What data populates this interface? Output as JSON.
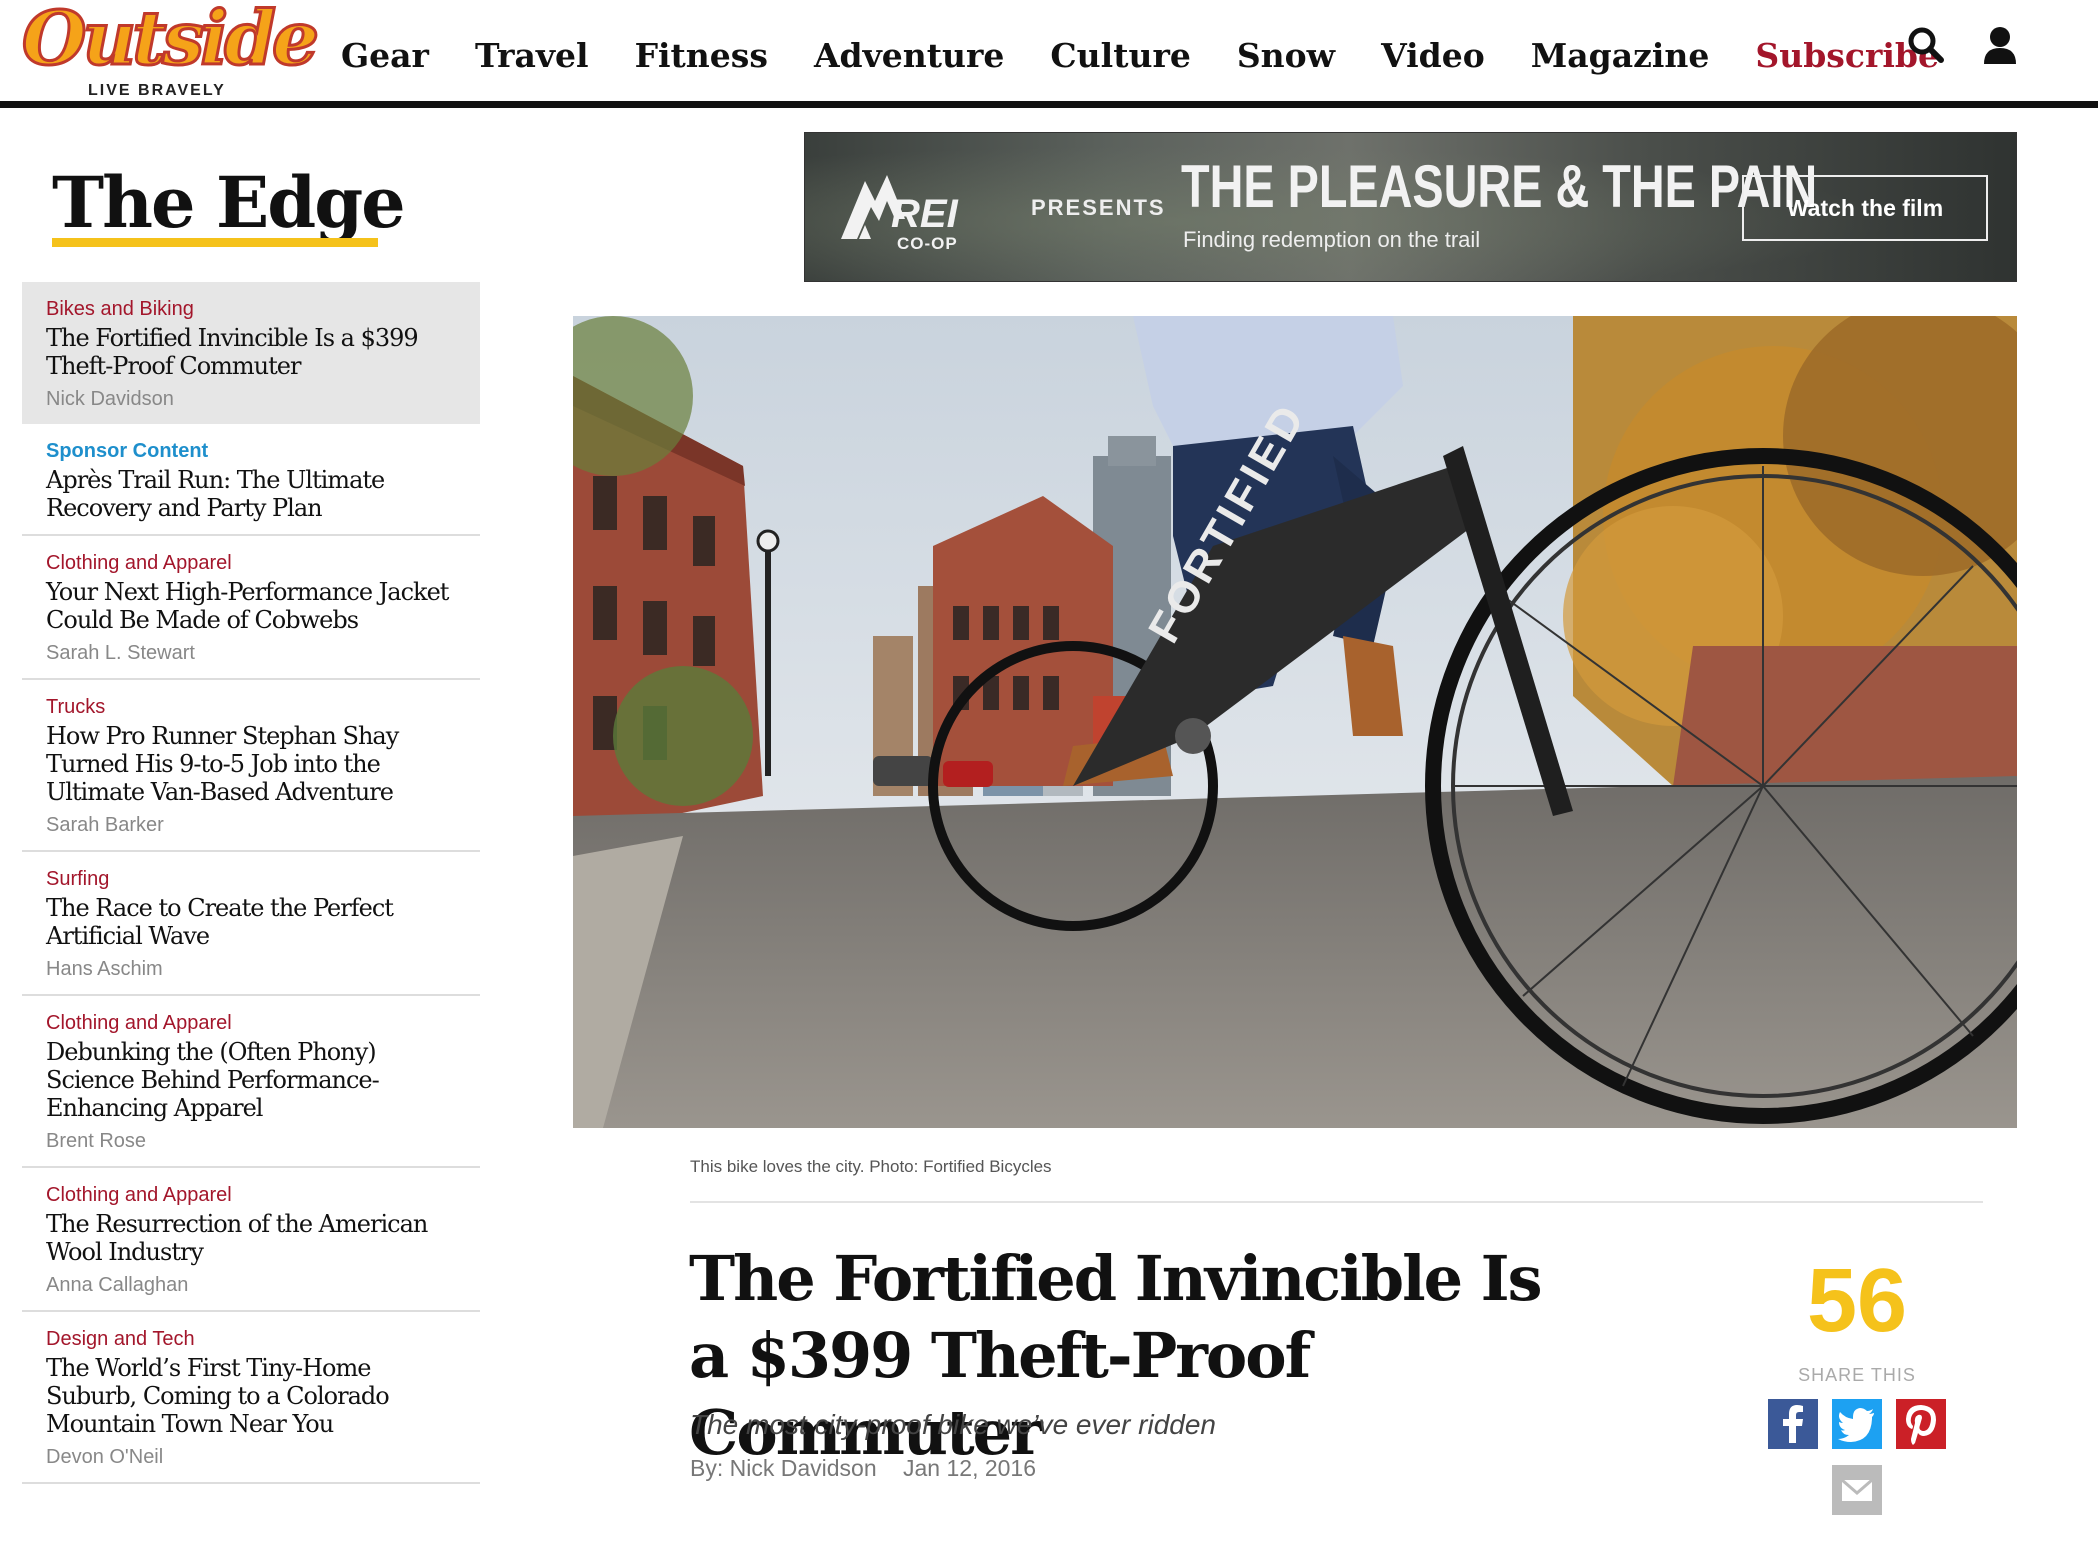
{
  "header": {
    "logo_text": "Outside",
    "logo_tagline": "LIVE BRAVELY",
    "nav": [
      "Gear",
      "Travel",
      "Fitness",
      "Adventure",
      "Culture",
      "Snow",
      "Video",
      "Magazine"
    ],
    "subscribe_label": "Subscribe",
    "icons": [
      "search-icon",
      "user-icon"
    ]
  },
  "sidebar": {
    "title": "The Edge",
    "items": [
      {
        "category": "Bikes and Biking",
        "title": "The Fortified Invincible Is a $399 Theft-Proof Commuter",
        "author": "Nick Davidson",
        "active": true
      },
      {
        "category": "Sponsor Content",
        "title": "Après Trail Run: The Ultimate Recovery and Party Plan",
        "author": "",
        "sponsor": true
      },
      {
        "category": "Clothing and Apparel",
        "title": "Your Next High-Performance Jacket Could Be Made of Cobwebs",
        "author": "Sarah L. Stewart"
      },
      {
        "category": "Trucks",
        "title": "How Pro Runner Stephan Shay Turned His 9-to-5 Job into the Ultimate Van-Based Adventure",
        "author": "Sarah Barker"
      },
      {
        "category": "Surfing",
        "title": "The Race to Create the Perfect Artificial Wave",
        "author": "Hans Aschim"
      },
      {
        "category": "Clothing and Apparel",
        "title": "Debunking the (Often Phony) Science Behind Performance-Enhancing Apparel",
        "author": "Brent Rose"
      },
      {
        "category": "Clothing and Apparel",
        "title": "The Resurrection of the American Wool Industry",
        "author": "Anna Callaghan"
      },
      {
        "category": "Design and Tech",
        "title": "The World’s First Tiny-Home Suburb, Coming to a Colorado Mountain Town Near You",
        "author": "Devon O'Neil"
      }
    ]
  },
  "ad": {
    "brand": "REI",
    "brand_sub": "CO-OP",
    "presents": "PRESENTS",
    "headline": "THE PLEASURE & THE PAIN",
    "subhead": "Finding redemption on the trail",
    "cta": "Watch the film"
  },
  "hero": {
    "caption": "This bike loves the city. Photo: Fortified Bicycles",
    "bike_brand": "FORTIFIED"
  },
  "article": {
    "title": "The Fortified Invincible Is a $399 Theft-Proof Commuter",
    "dek": "The most city-proof bike we’ve ever ridden",
    "byline": "By: Nick Davidson",
    "date": "Jan 12, 2016"
  },
  "share": {
    "count": "56",
    "label": "SHARE THIS",
    "buttons": [
      "facebook-icon",
      "twitter-icon",
      "pinterest-icon",
      "email-icon"
    ]
  },
  "colors": {
    "brand_red": "#a3162b",
    "edge_yellow": "#f5c21b",
    "sponsor_blue": "#1e8fcc",
    "facebook": "#3b5998",
    "twitter": "#1da1f2",
    "pinterest": "#cb2027"
  }
}
